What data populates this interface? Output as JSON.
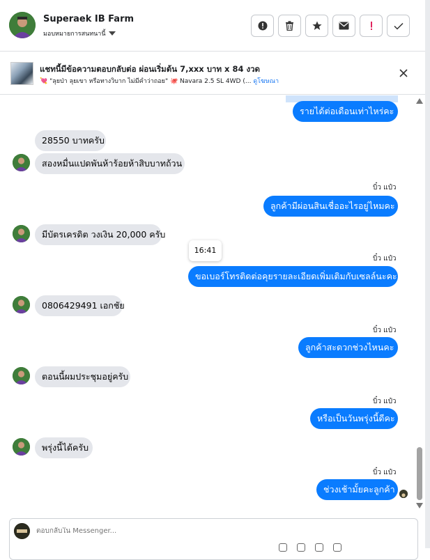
{
  "header": {
    "name": "Superaek IB Farm",
    "assign_label": "มอบหมายการสนทนานี้",
    "actions": [
      "mark-spam",
      "delete",
      "star",
      "mark-unread",
      "follow-up",
      "done"
    ]
  },
  "ad": {
    "title": "แชทนี้มีข้อความตอบกลับต่อ ผ่อนเริ่มต้น 7,xxx บาท x 84 งวด",
    "subtitle": "💘 \"ลุยป่า ลุยเขา หรือทางวิบาก ไม่มีคำว่าถอย\" 🐙 Navara 2.5 SL 4WD (...",
    "link": "ดูโฆษณา"
  },
  "chat": {
    "agent_name": "บิ๋ว แป๋ว",
    "tooltip_time": "16:41",
    "messages": [
      {
        "dir": "out",
        "text": "รายได้ต่อเดือนเท่าไหร่คะ"
      },
      {
        "dir": "in",
        "text": "28550 บาทครับ"
      },
      {
        "dir": "in",
        "text": "สองหมื่นแปดพันห้าร้อยห้าสิบบาทถ้วน"
      },
      {
        "dir": "out",
        "text": "ลูกค้ามีผ่อนสินเชื่ออะไรอยู่ไหมคะ"
      },
      {
        "dir": "in",
        "text": "มีบัตรเครดิต วงเงิน 20,000 ครับ"
      },
      {
        "dir": "out",
        "text": "ขอเบอร์โทรติดต่อคุยรายละเอียดเพิ่มเติมกับเซลล์นะคะ"
      },
      {
        "dir": "in",
        "text": "0806429491 เอกชัย"
      },
      {
        "dir": "out",
        "text": "ลูกค้าสะดวกช่วงไหนคะ"
      },
      {
        "dir": "in",
        "text": "ตอนนี้ผมประชุมอยู่ครับ"
      },
      {
        "dir": "out",
        "text": "หรือเป็นวันพรุ่งนี้ดีคะ"
      },
      {
        "dir": "in",
        "text": "พรุ่งนี้ได้ครับ"
      },
      {
        "dir": "out",
        "text": "ช่วงเช้ามั้ยคะลูกค้า"
      }
    ]
  },
  "reply": {
    "placeholder": "ตอบกลับใน Messenger..."
  },
  "colors": {
    "outgoing": "#0a7cff",
    "incoming": "#e4e6eb",
    "link": "#1877f2"
  }
}
